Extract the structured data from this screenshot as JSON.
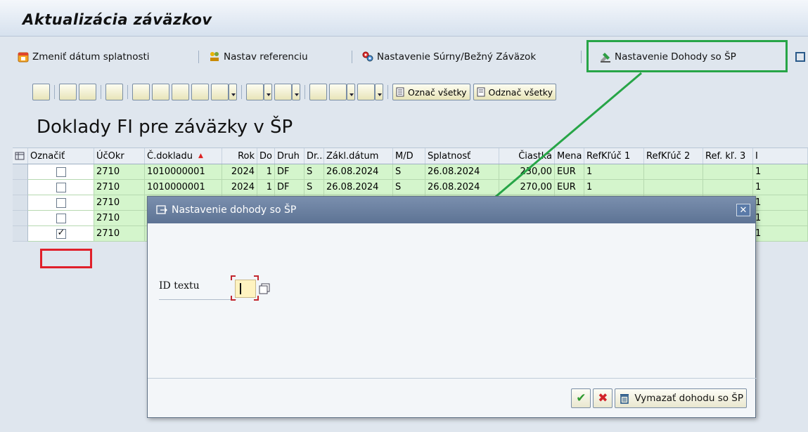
{
  "window": {
    "title": "Aktualizácia záväzkov"
  },
  "app_toolbar": {
    "items": [
      {
        "label": "Zmeniť dátum splatnosti",
        "icon": "calendar-icon"
      },
      {
        "label": "Nastav referenciu",
        "icon": "reference-icon"
      },
      {
        "label": "Nastavenie Súrny/Bežný Záväzok",
        "icon": "settings-icon"
      },
      {
        "label": "Nastavenie Dohody so ŠP",
        "icon": "agreement-icon"
      }
    ]
  },
  "grid_toolbar": {
    "select_all_label": "Označ všetky",
    "deselect_all_label": "Odznač všetky"
  },
  "grid": {
    "title": "Doklady FI pre záväzky v ŠP",
    "columns": [
      "Označiť",
      "ÚčOkr",
      "Č.dokladu",
      "Rok",
      "Do",
      "Druh",
      "Dr...",
      "Zákl.dátum",
      "M/D",
      "Splatnosť",
      "Čiastka",
      "Mena",
      "RefKľúč 1",
      "RefKľúč 2",
      "Ref. kľ. 3"
    ],
    "rows": [
      {
        "checked": false,
        "ucokr": "2710",
        "doklad": "1010000001",
        "rok": "2024",
        "do": "1",
        "druh": "DF",
        "dr": "S",
        "datum": "26.08.2024",
        "md": "S",
        "splatnost": "26.08.2024",
        "ciastka": "230,00",
        "mena": "EUR",
        "ref1": "1",
        "ref2": "",
        "ref3": "",
        "last": "1"
      },
      {
        "checked": false,
        "ucokr": "2710",
        "doklad": "1010000001",
        "rok": "2024",
        "do": "1",
        "druh": "DF",
        "dr": "S",
        "datum": "26.08.2024",
        "md": "S",
        "splatnost": "26.08.2024",
        "ciastka": "270,00",
        "mena": "EUR",
        "ref1": "1",
        "ref2": "",
        "ref3": "",
        "last": "1"
      },
      {
        "checked": false,
        "ucokr": "2710",
        "last": "1"
      },
      {
        "checked": false,
        "ucokr": "2710",
        "last": "1"
      },
      {
        "checked": true,
        "ucokr": "2710",
        "last": "1"
      }
    ]
  },
  "dialog": {
    "title": "Nastavenie dohody so ŠP",
    "field_label": "ID textu",
    "field_value": "",
    "delete_button_label": "Vymazať dohodu so ŠP"
  },
  "colors": {
    "highlight_green": "#27a547",
    "highlight_red": "#e0202a",
    "row_green": "#d4f5cc",
    "dialog_header": "#5d7394"
  }
}
